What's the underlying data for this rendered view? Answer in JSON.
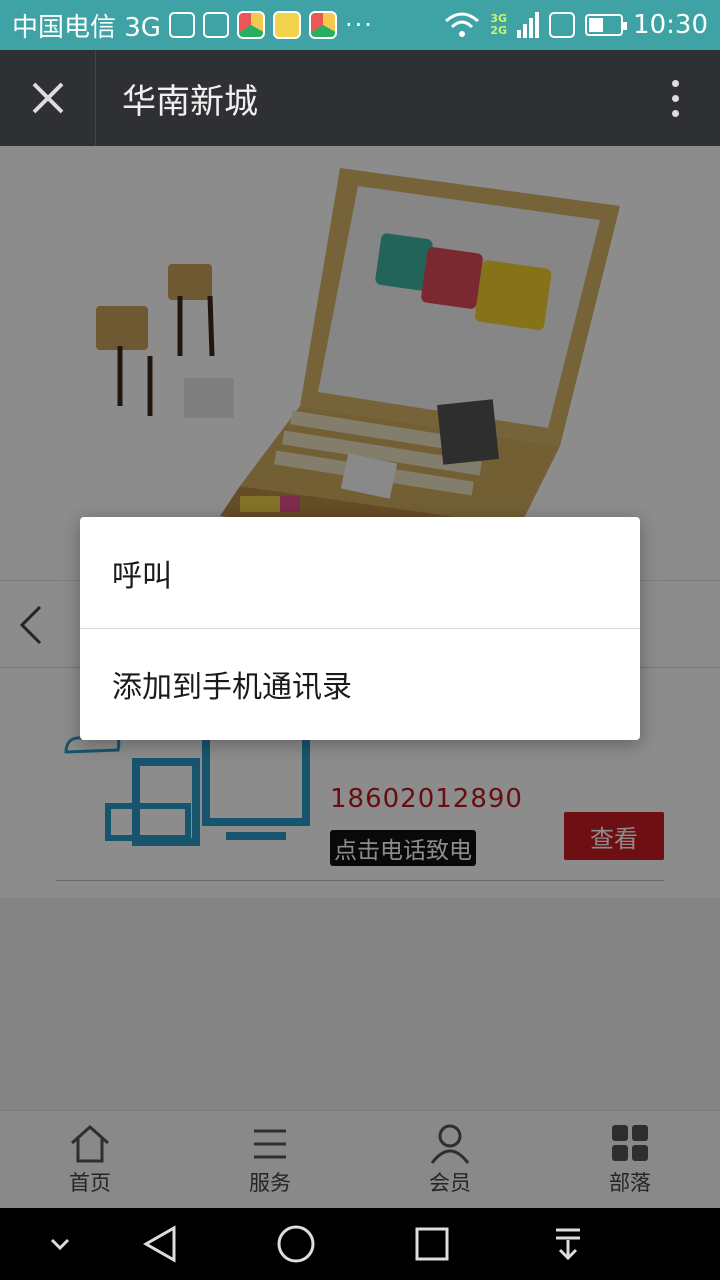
{
  "status_bar": {
    "carrier": "中国电信 3G",
    "net_top": "3G",
    "net_bottom": "2G",
    "time": "10:30",
    "more": "···",
    "icons": [
      "usb-icon",
      "image-icon",
      "browser-icon",
      "camera-app-icon",
      "browser-icon",
      "wifi-icon",
      "signal-icon",
      "sim-icon",
      "battery-icon"
    ]
  },
  "title_bar": {
    "title": "华南新城",
    "close_icon": "close-icon",
    "more_icon": "more-vert-icon"
  },
  "card": {
    "phone": "18602012890",
    "call_hint": "点击电话致电",
    "view_label": "查看"
  },
  "dialog": {
    "items": [
      {
        "label": "呼叫"
      },
      {
        "label": "添加到手机通讯录"
      }
    ]
  },
  "tab_bar": {
    "tabs": [
      {
        "label": "首页",
        "icon": "home-icon"
      },
      {
        "label": "服务",
        "icon": "list-icon"
      },
      {
        "label": "会员",
        "icon": "user-icon"
      },
      {
        "label": "部落",
        "icon": "grid-icon"
      }
    ]
  },
  "colors": {
    "status_bar": "#3fa2a4",
    "title_bar": "#2e3033",
    "accent_red": "#c91e24",
    "phone_red": "#c2191f"
  }
}
